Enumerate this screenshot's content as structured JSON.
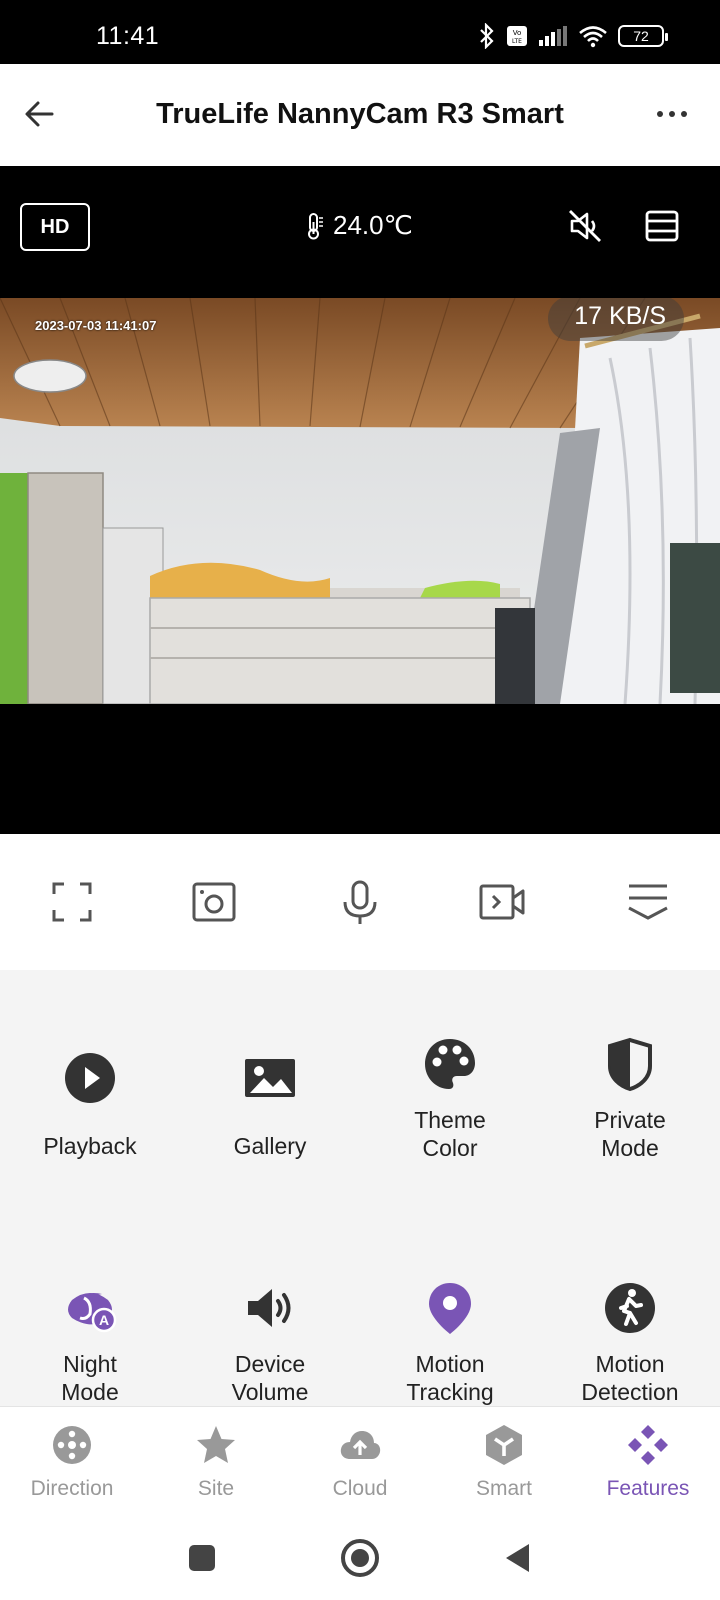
{
  "status_bar": {
    "time": "11:41",
    "battery": "72"
  },
  "header": {
    "title": "TrueLife NannyCam R3 Smart"
  },
  "video": {
    "quality_label": "HD",
    "temperature": "24.0℃",
    "timestamp": "2023-07-03 11:41:07",
    "data_rate": "17 KB/S"
  },
  "controls": [
    "fullscreen",
    "snapshot",
    "microphone",
    "record",
    "more"
  ],
  "features": [
    {
      "label": "Playback",
      "icon": "play-circle-icon",
      "color": "#333333"
    },
    {
      "label": "Gallery",
      "icon": "image-icon",
      "color": "#333333"
    },
    {
      "label": "Theme\nColor",
      "icon": "palette-icon",
      "color": "#333333"
    },
    {
      "label": "Private\nMode",
      "icon": "shield-icon",
      "color": "#333333"
    },
    {
      "label": "Night\nMode",
      "icon": "night-mode-auto-icon",
      "color": "#7a55b5"
    },
    {
      "label": "Device\nVolume",
      "icon": "volume-icon",
      "color": "#333333"
    },
    {
      "label": "Motion\nTracking",
      "icon": "location-pin-icon",
      "color": "#7a55b5"
    },
    {
      "label": "Motion\nDetection",
      "icon": "walking-person-icon",
      "color": "#333333"
    }
  ],
  "tabs": [
    {
      "label": "Direction",
      "icon": "direction-pad-icon",
      "active": false
    },
    {
      "label": "Site",
      "icon": "star-icon",
      "active": false
    },
    {
      "label": "Cloud",
      "icon": "cloud-upload-icon",
      "active": false
    },
    {
      "label": "Smart",
      "icon": "smart-hexagon-icon",
      "active": false
    },
    {
      "label": "Features",
      "icon": "features-diamond-icon",
      "active": true
    }
  ],
  "colors": {
    "accent": "#7a55b5",
    "icon_dark": "#333333",
    "tab_inactive": "#999999"
  }
}
